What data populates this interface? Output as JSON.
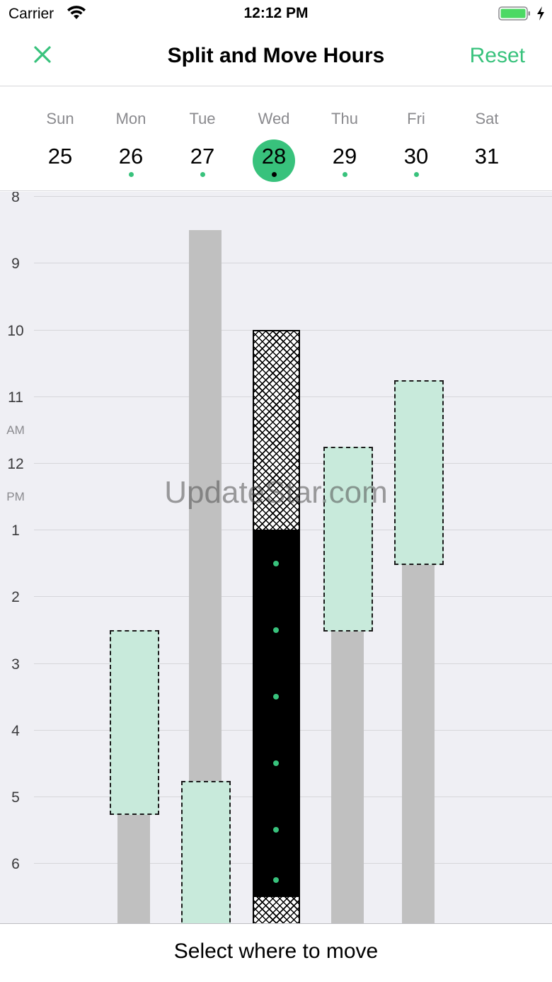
{
  "status_bar": {
    "carrier": "Carrier",
    "time": "12:12 PM",
    "wifi_icon": "wifi-icon",
    "battery_icon": "battery-icon",
    "battery_color": "#4cd964"
  },
  "nav": {
    "title": "Split and Move Hours",
    "close_icon": "close-icon",
    "reset_label": "Reset",
    "accent_color": "#38c27c"
  },
  "week": {
    "days": [
      {
        "name": "Sun",
        "date": "25",
        "has_dot": false,
        "selected": false
      },
      {
        "name": "Mon",
        "date": "26",
        "has_dot": true,
        "selected": false
      },
      {
        "name": "Tue",
        "date": "27",
        "has_dot": true,
        "selected": false
      },
      {
        "name": "Wed",
        "date": "28",
        "has_dot": true,
        "selected": true
      },
      {
        "name": "Thu",
        "date": "29",
        "has_dot": true,
        "selected": false
      },
      {
        "name": "Fri",
        "date": "30",
        "has_dot": true,
        "selected": false
      },
      {
        "name": "Sat",
        "date": "31",
        "has_dot": false,
        "selected": false
      }
    ]
  },
  "timeline": {
    "hour_labels": [
      "8",
      "9",
      "10",
      "11",
      "12",
      "1",
      "2",
      "3",
      "4",
      "5",
      "6"
    ],
    "am_label": "AM",
    "pm_label": "PM"
  },
  "watermark": "UpdateStar.com",
  "bottom": {
    "instruction": "Select where to move"
  }
}
